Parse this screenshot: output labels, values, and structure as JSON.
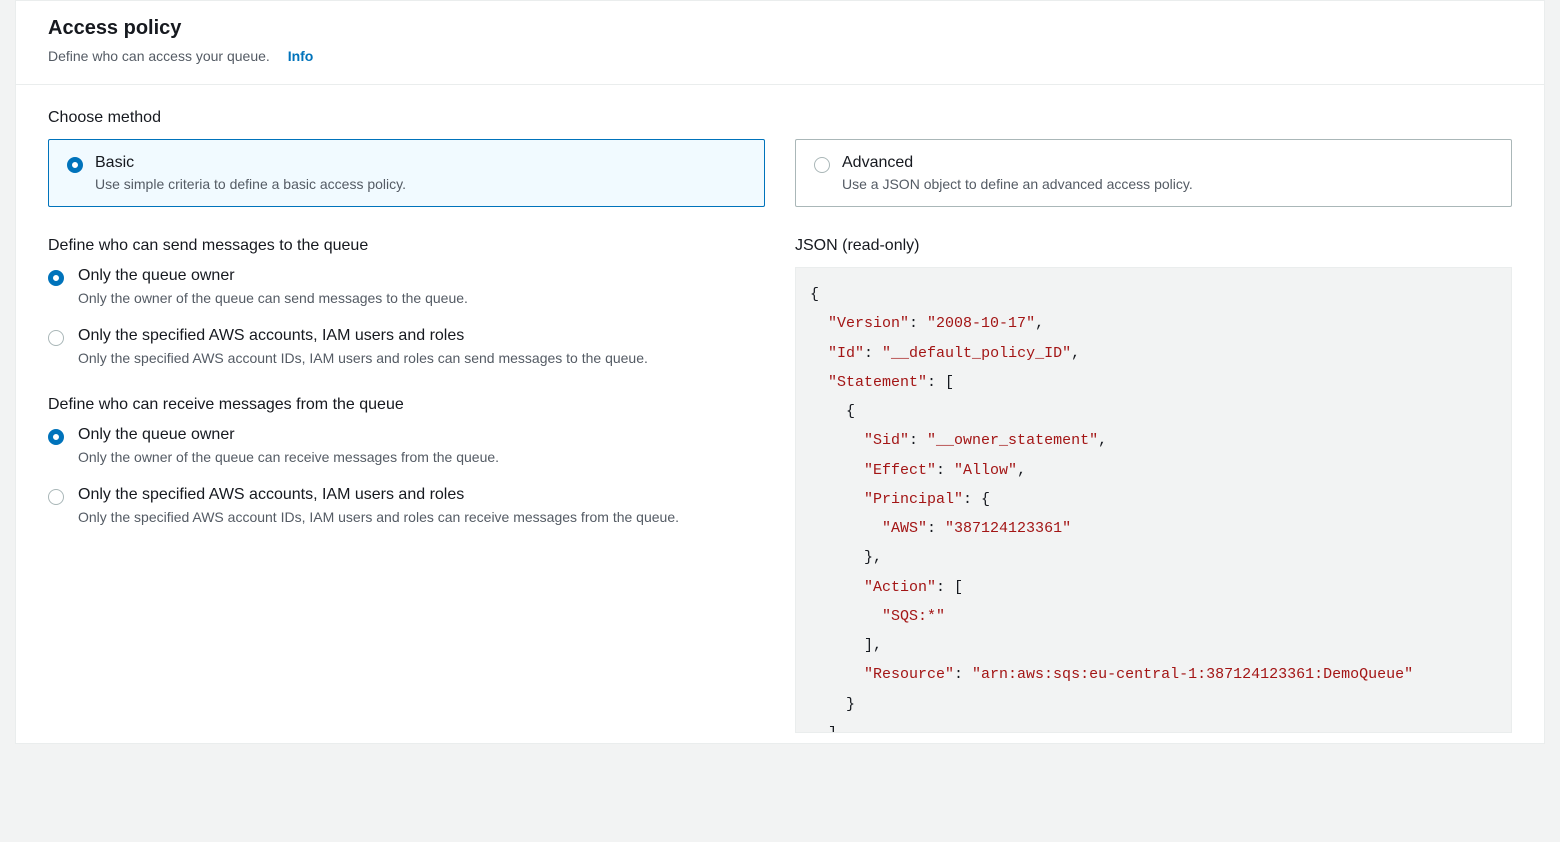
{
  "header": {
    "title": "Access policy",
    "description": "Define who can access your queue.",
    "info": "Info"
  },
  "method": {
    "label": "Choose method",
    "basic": {
      "title": "Basic",
      "desc": "Use simple criteria to define a basic access policy."
    },
    "advanced": {
      "title": "Advanced",
      "desc": "Use a JSON object to define an advanced access policy."
    }
  },
  "send": {
    "label": "Define who can send messages to the queue",
    "owner": {
      "title": "Only the queue owner",
      "desc": "Only the owner of the queue can send messages to the queue."
    },
    "specified": {
      "title": "Only the specified AWS accounts, IAM users and roles",
      "desc": "Only the specified AWS account IDs, IAM users and roles can send messages to the queue."
    }
  },
  "receive": {
    "label": "Define who can receive messages from the queue",
    "owner": {
      "title": "Only the queue owner",
      "desc": "Only the owner of the queue can receive messages from the queue."
    },
    "specified": {
      "title": "Only the specified AWS accounts, IAM users and roles",
      "desc": "Only the specified AWS account IDs, IAM users and roles can receive messages from the queue."
    }
  },
  "json": {
    "label": "JSON (read-only)",
    "policy": {
      "Version": "2008-10-17",
      "Id": "__default_policy_ID",
      "Statement": [
        {
          "Sid": "__owner_statement",
          "Effect": "Allow",
          "Principal": {
            "AWS": "387124123361"
          },
          "Action": [
            "SQS:*"
          ],
          "Resource": "arn:aws:sqs:eu-central-1:387124123361:DemoQueue"
        }
      ]
    }
  }
}
